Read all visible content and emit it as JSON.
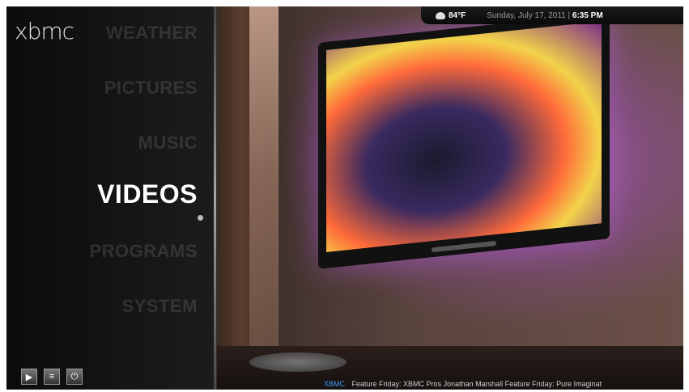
{
  "app": {
    "logo": "xbmc"
  },
  "menu": {
    "items": [
      {
        "label": "Weather"
      },
      {
        "label": "Pictures"
      },
      {
        "label": "Music"
      },
      {
        "label": "Videos"
      },
      {
        "label": "Programs"
      },
      {
        "label": "System"
      }
    ],
    "selected_index": 3
  },
  "status": {
    "temperature": "84°F",
    "date": "Sunday, July 17, 2011",
    "separator": "|",
    "time": "6:35 PM"
  },
  "controls": {
    "play_icon": "play-icon",
    "favourites_icon": "favourites-icon",
    "power_icon": "power-icon"
  },
  "ticker": {
    "source": "XBMC",
    "text": "Feature Friday: XBMC Pros Jonathan Marshall   Feature Friday: Pure Imaginat"
  },
  "colors": {
    "ticker_source": "#3a9bff",
    "menu_selected": "#ffffff",
    "tv_glow": "#d070ff"
  }
}
